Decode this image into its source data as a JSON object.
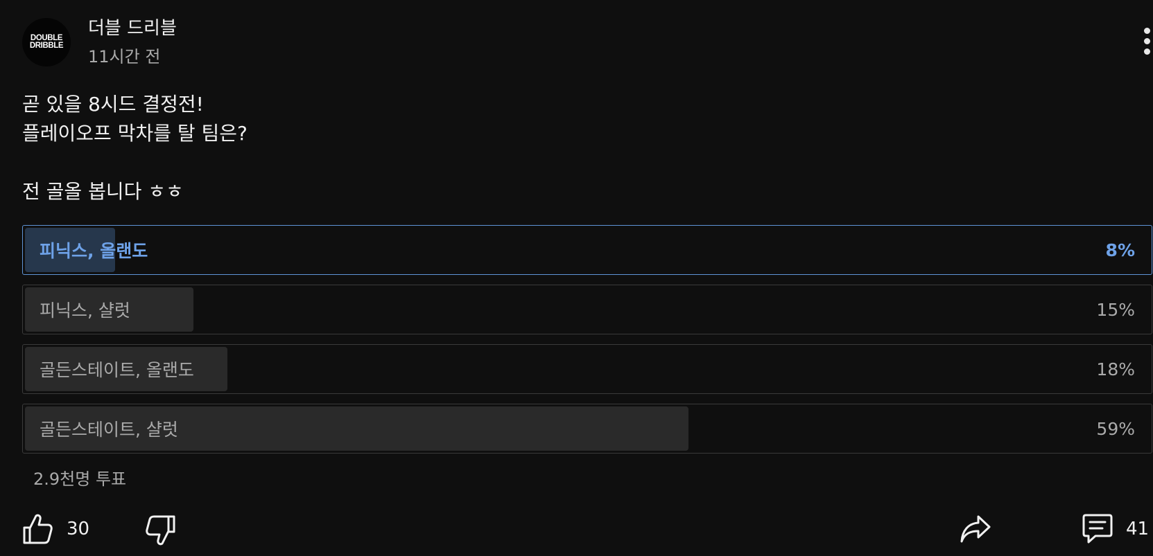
{
  "header": {
    "avatar_logo": [
      "DOUBLE",
      "DRIBBLE"
    ],
    "channel_name": "더블 드리블",
    "post_time": "11시간 전",
    "more_icon": "more-vertical-icon"
  },
  "post": {
    "lines": [
      "곧 있을 8시드 결정전!",
      "플레이오프 막차를 탈 팀은?",
      "",
      "전 골올 봅니다 ㅎㅎ"
    ]
  },
  "poll": {
    "options": [
      {
        "label": "피닉스, 올랜도",
        "percent_text": "8%",
        "percent": 8,
        "selected": true
      },
      {
        "label": "피닉스, 샬럿",
        "percent_text": "15%",
        "percent": 15,
        "selected": false
      },
      {
        "label": "골든스테이트, 올랜도",
        "percent_text": "18%",
        "percent": 18,
        "selected": false
      },
      {
        "label": "골든스테이트, 샬럿",
        "percent_text": "59%",
        "percent": 59,
        "selected": false
      }
    ],
    "vote_count": "2.9천명 투표"
  },
  "actions": {
    "like_icon": "thumbs-up-icon",
    "like_count": "30",
    "dislike_icon": "thumbs-down-icon",
    "share_icon": "share-icon",
    "comment_icon": "comment-icon",
    "comment_count": "41"
  },
  "colors": {
    "background": "#0f0f0f",
    "selected_accent": "#6ea2e8",
    "selected_border": "#5f95d8",
    "option_border": "#3a3a3a",
    "option_fill": "#2a2a2a",
    "selected_fill": "#26374c",
    "secondary_text": "#aaaaaa"
  }
}
